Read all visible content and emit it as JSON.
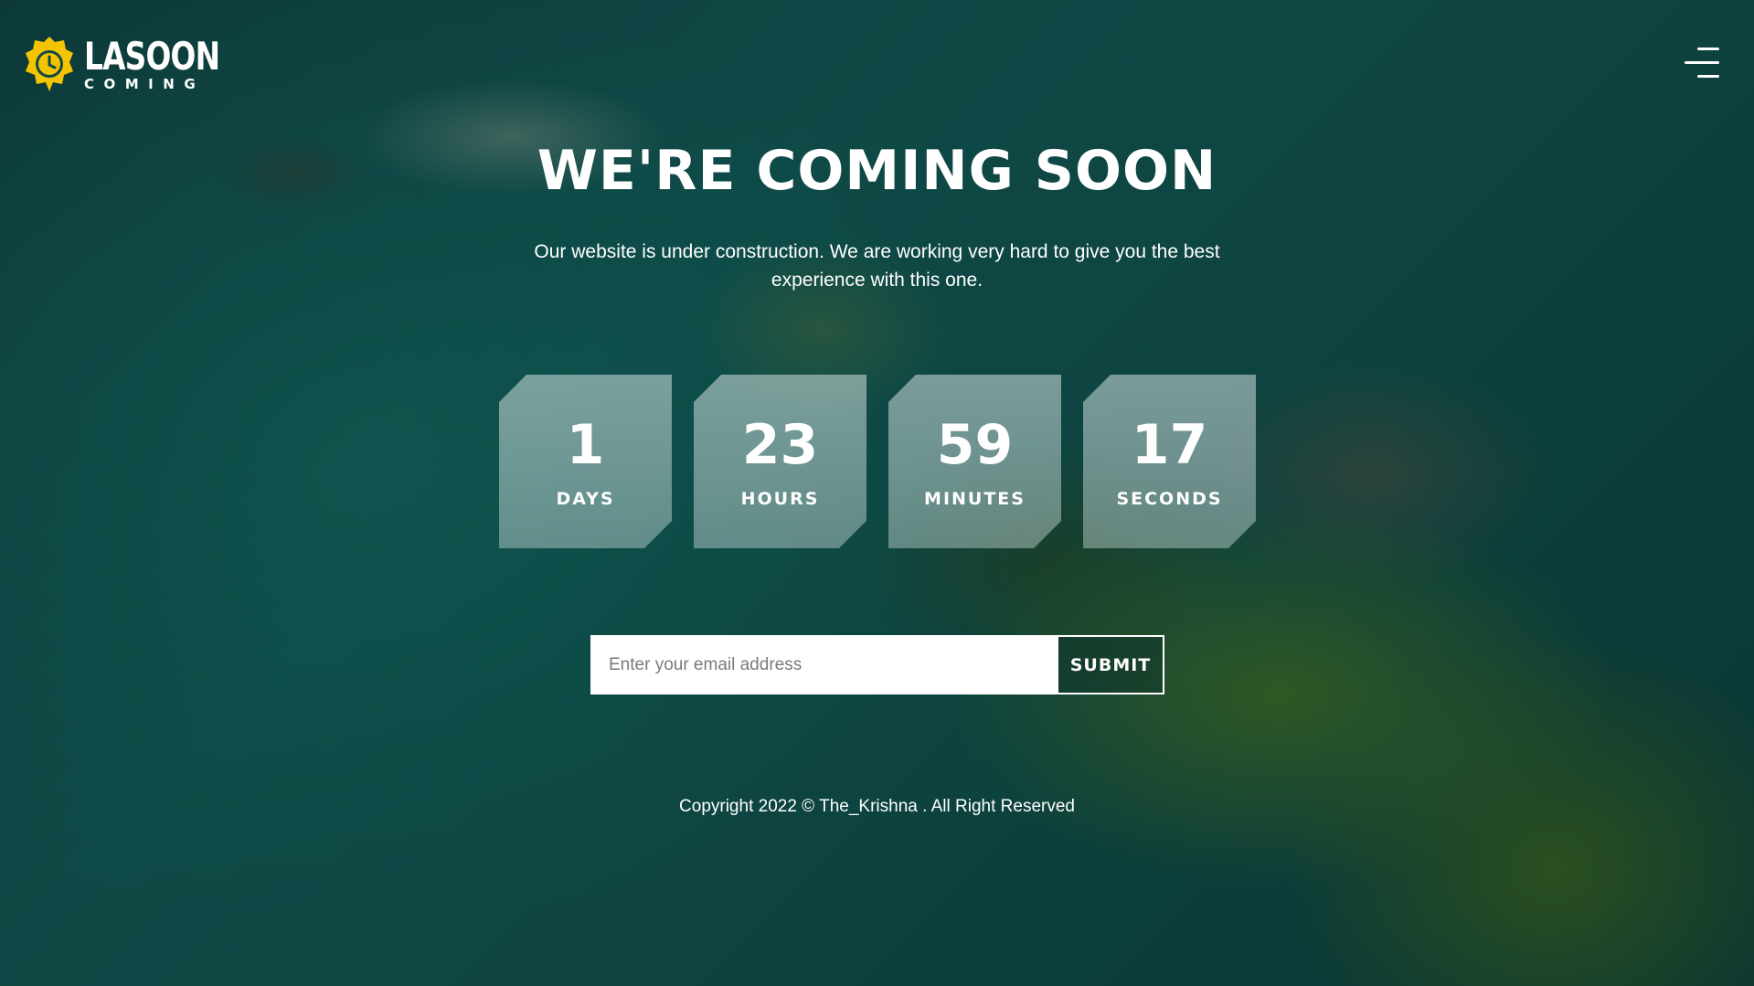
{
  "brand": {
    "name": "LASOON",
    "tagline": "COMING",
    "logo_icon": "clock-shield-icon",
    "accent_color": "#f5c400"
  },
  "header": {
    "menu_icon": "hamburger-menu-icon"
  },
  "hero": {
    "title": "WE'RE COMING SOON",
    "subtitle": "Our website is under construction. We are working very hard to give you the best experience with this one."
  },
  "countdown": [
    {
      "value": "1",
      "label": "DAYS"
    },
    {
      "value": "23",
      "label": "HOURS"
    },
    {
      "value": "59",
      "label": "MINUTES"
    },
    {
      "value": "17",
      "label": "SECONDS"
    }
  ],
  "subscribe": {
    "placeholder": "Enter your email address",
    "value": "",
    "submit_label": "SUBMIT"
  },
  "footer": {
    "copyright": "Copyright 2022 © The_Krishna . All Right Reserved"
  }
}
